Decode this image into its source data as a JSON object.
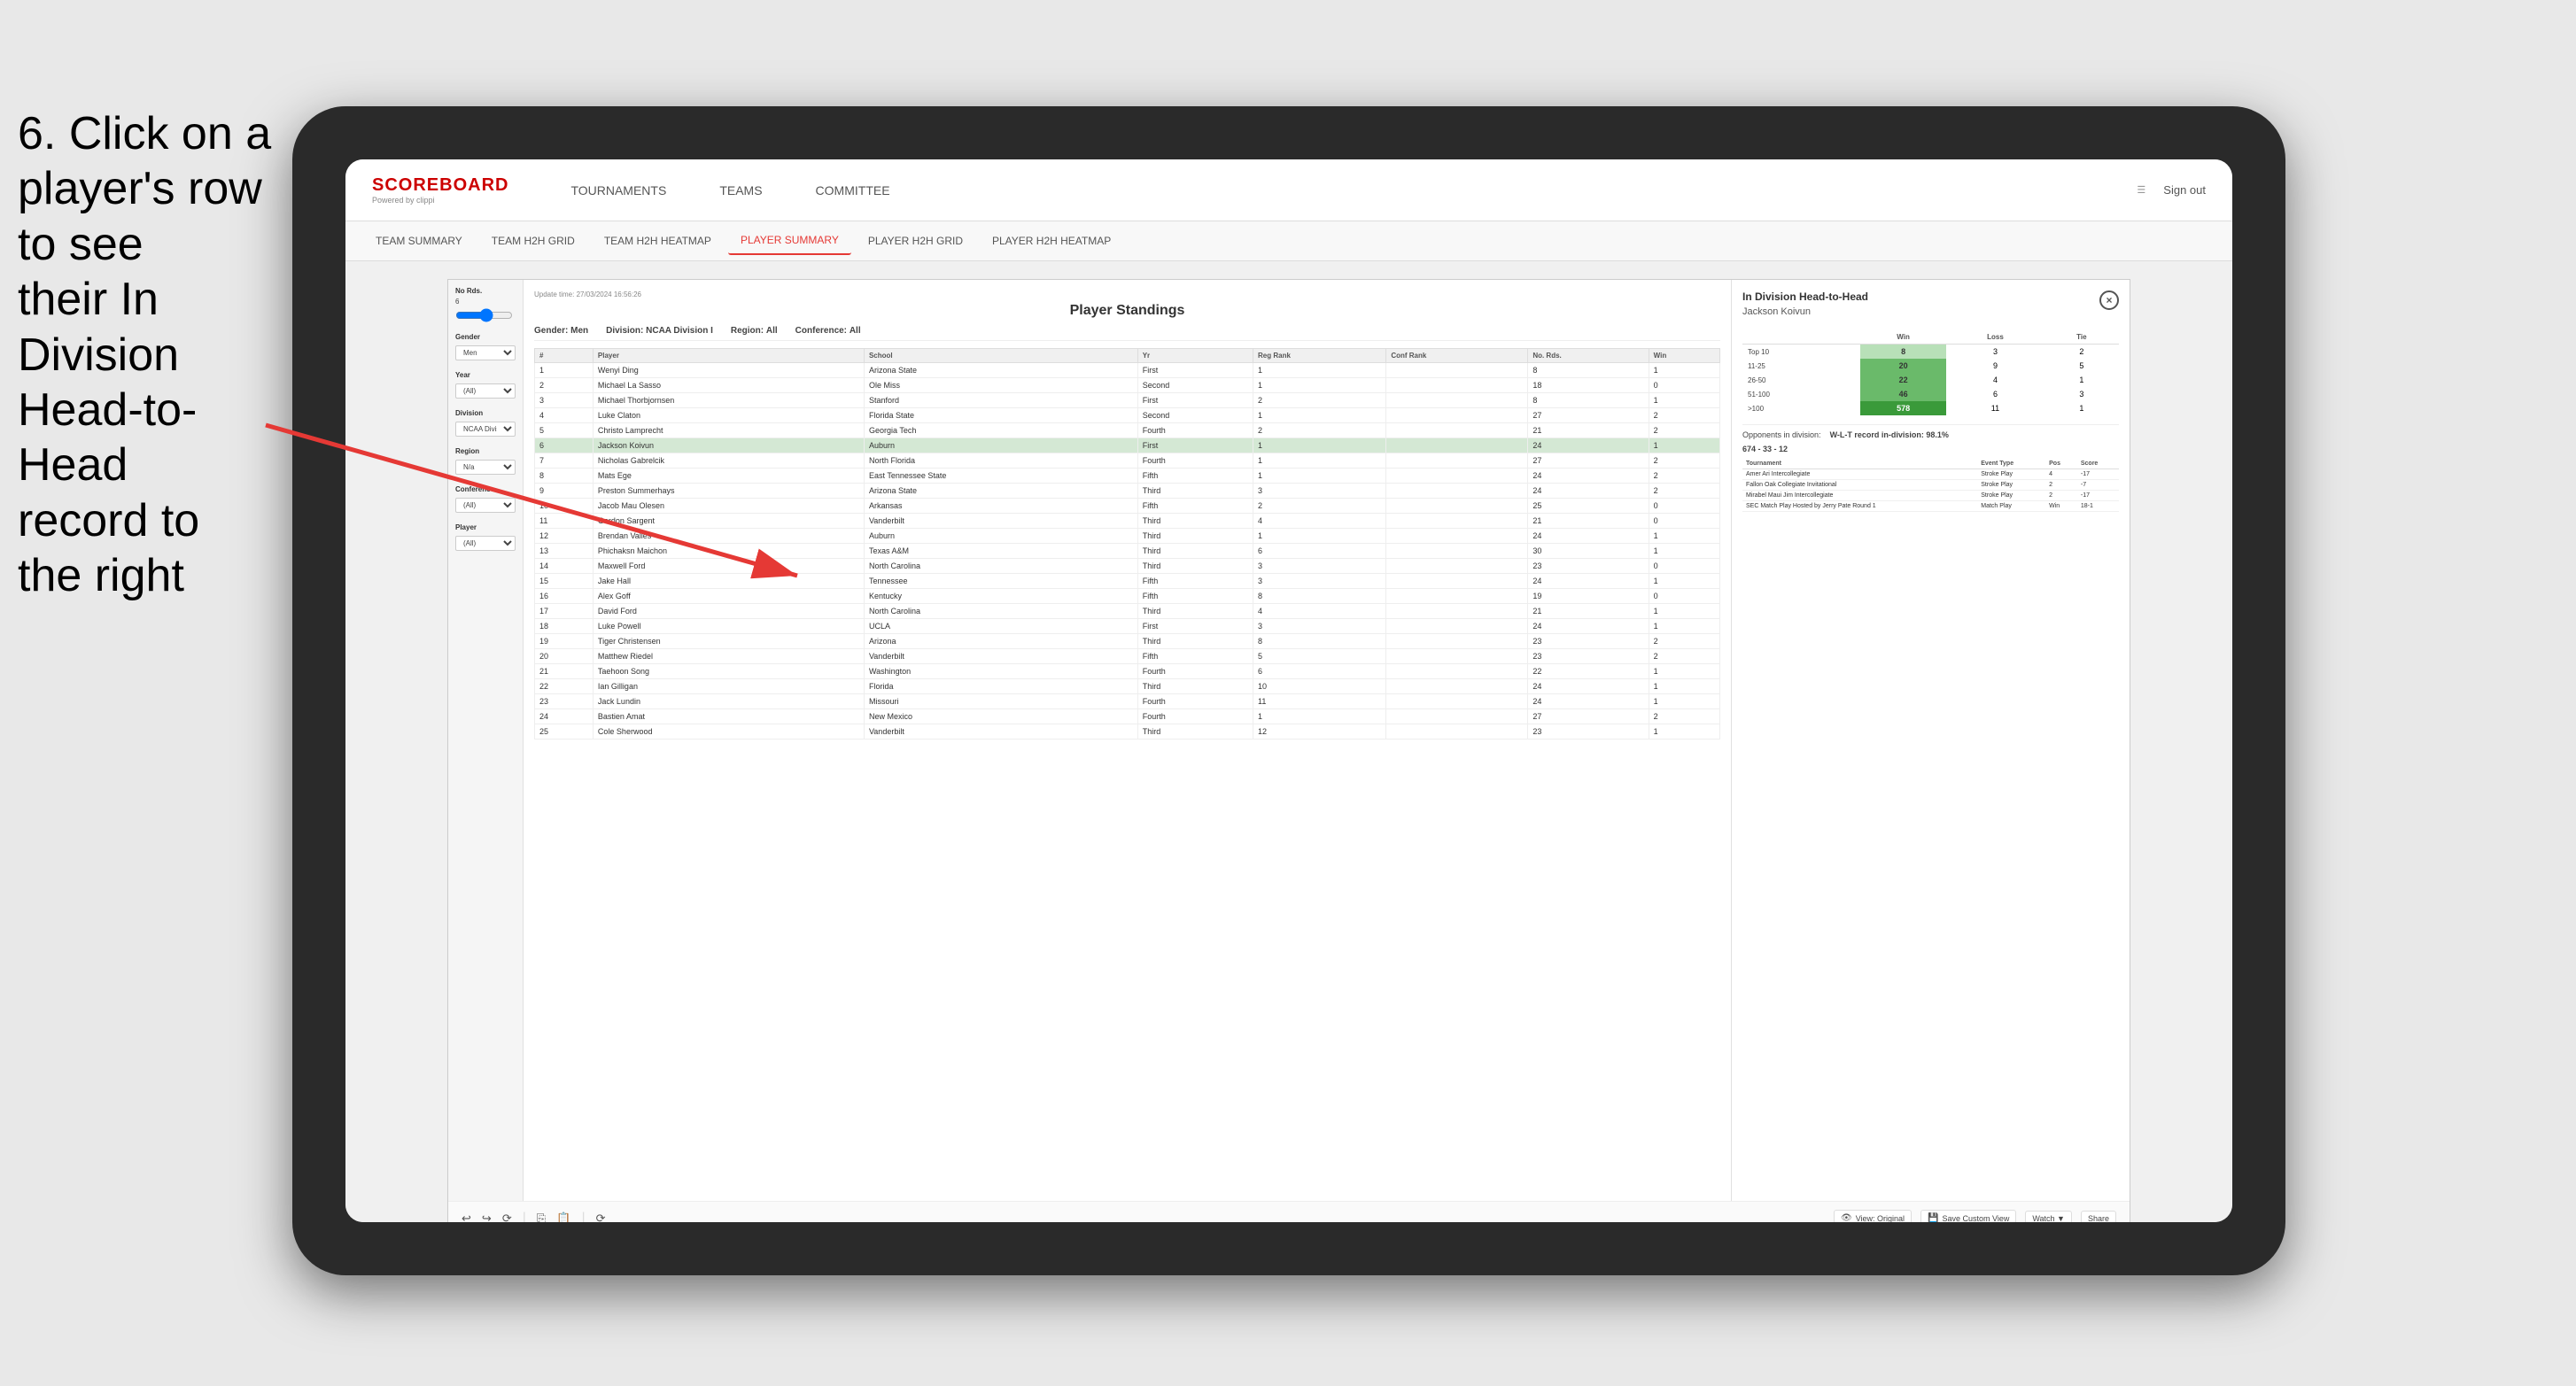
{
  "instruction": {
    "line1": "6. Click on a",
    "line2": "player's row to see",
    "line3": "their In Division",
    "line4": "Head-to-Head",
    "line5": "record to the right"
  },
  "nav": {
    "logo": "SCOREBOARD",
    "logo_sub": "Powered by clippi",
    "items": [
      "TOURNAMENTS",
      "TEAMS",
      "COMMITTEE"
    ],
    "sign_out": "Sign out"
  },
  "sub_nav": {
    "items": [
      "TEAM SUMMARY",
      "TEAM H2H GRID",
      "TEAM H2H HEATMAP",
      "PLAYER SUMMARY",
      "PLAYER H2H GRID",
      "PLAYER H2H HEATMAP"
    ],
    "active": "PLAYER SUMMARY"
  },
  "report": {
    "update_time_label": "Update time:",
    "update_time": "27/03/2024 16:56:26",
    "title": "Player Standings",
    "gender_label": "Gender:",
    "gender_value": "Men",
    "division_label": "Division:",
    "division_value": "NCAA Division I",
    "region_label": "Region:",
    "region_value": "All",
    "conference_label": "Conference:",
    "conference_value": "All"
  },
  "filters": {
    "no_rds_label": "No Rds.",
    "no_rds_value": "6",
    "gender_label": "Gender",
    "gender_value": "Men",
    "year_label": "Year",
    "year_value": "(All)",
    "division_label": "Division",
    "division_value": "NCAA Division I",
    "region_label": "Region",
    "region_value": "N/a",
    "conference_label": "Conference",
    "conference_value": "(All)",
    "player_label": "Player",
    "player_value": "(All)"
  },
  "table": {
    "headers": [
      "#",
      "Player",
      "School",
      "Yr",
      "Reg Rank",
      "Conf Rank",
      "No. Rds.",
      "Win"
    ],
    "rows": [
      {
        "rank": 1,
        "player": "Wenyi Ding",
        "school": "Arizona State",
        "yr": "First",
        "reg_rank": 1,
        "conf_rank": "",
        "rds": 8,
        "win": 1
      },
      {
        "rank": 2,
        "player": "Michael La Sasso",
        "school": "Ole Miss",
        "yr": "Second",
        "reg_rank": 1,
        "conf_rank": "",
        "rds": 18,
        "win": 0
      },
      {
        "rank": 3,
        "player": "Michael Thorbjornsen",
        "school": "Stanford",
        "yr": "First",
        "reg_rank": 2,
        "conf_rank": "",
        "rds": 8,
        "win": 1
      },
      {
        "rank": 4,
        "player": "Luke Claton",
        "school": "Florida State",
        "yr": "Second",
        "reg_rank": 1,
        "conf_rank": "",
        "rds": 27,
        "win": 2
      },
      {
        "rank": 5,
        "player": "Christo Lamprecht",
        "school": "Georgia Tech",
        "yr": "Fourth",
        "reg_rank": 2,
        "conf_rank": "",
        "rds": 21,
        "win": 2
      },
      {
        "rank": 6,
        "player": "Jackson Koivun",
        "school": "Auburn",
        "yr": "First",
        "reg_rank": 1,
        "conf_rank": "",
        "rds": 24,
        "win": 1,
        "highlighted": true
      },
      {
        "rank": 7,
        "player": "Nicholas Gabrelcik",
        "school": "North Florida",
        "yr": "Fourth",
        "reg_rank": 1,
        "conf_rank": "",
        "rds": 27,
        "win": 2
      },
      {
        "rank": 8,
        "player": "Mats Ege",
        "school": "East Tennessee State",
        "yr": "Fifth",
        "reg_rank": 1,
        "conf_rank": "",
        "rds": 24,
        "win": 2
      },
      {
        "rank": 9,
        "player": "Preston Summerhays",
        "school": "Arizona State",
        "yr": "Third",
        "reg_rank": 3,
        "conf_rank": "",
        "rds": 24,
        "win": 2
      },
      {
        "rank": 10,
        "player": "Jacob Mau Olesen",
        "school": "Arkansas",
        "yr": "Fifth",
        "reg_rank": 2,
        "conf_rank": "",
        "rds": 25,
        "win": 0
      },
      {
        "rank": 11,
        "player": "Gordon Sargent",
        "school": "Vanderbilt",
        "yr": "Third",
        "reg_rank": 4,
        "conf_rank": "",
        "rds": 21,
        "win": 0
      },
      {
        "rank": 12,
        "player": "Brendan Valles",
        "school": "Auburn",
        "yr": "Third",
        "reg_rank": 1,
        "conf_rank": "",
        "rds": 24,
        "win": 1
      },
      {
        "rank": 13,
        "player": "Phichaksn Maichon",
        "school": "Texas A&M",
        "yr": "Third",
        "reg_rank": 6,
        "conf_rank": "",
        "rds": 30,
        "win": 1
      },
      {
        "rank": 14,
        "player": "Maxwell Ford",
        "school": "North Carolina",
        "yr": "Third",
        "reg_rank": 3,
        "conf_rank": "",
        "rds": 23,
        "win": 0
      },
      {
        "rank": 15,
        "player": "Jake Hall",
        "school": "Tennessee",
        "yr": "Fifth",
        "reg_rank": 3,
        "conf_rank": "",
        "rds": 24,
        "win": 1
      },
      {
        "rank": 16,
        "player": "Alex Goff",
        "school": "Kentucky",
        "yr": "Fifth",
        "reg_rank": 8,
        "conf_rank": "",
        "rds": 19,
        "win": 0
      },
      {
        "rank": 17,
        "player": "David Ford",
        "school": "North Carolina",
        "yr": "Third",
        "reg_rank": 4,
        "conf_rank": "",
        "rds": 21,
        "win": 1
      },
      {
        "rank": 18,
        "player": "Luke Powell",
        "school": "UCLA",
        "yr": "First",
        "reg_rank": 3,
        "conf_rank": "",
        "rds": 24,
        "win": 1
      },
      {
        "rank": 19,
        "player": "Tiger Christensen",
        "school": "Arizona",
        "yr": "Third",
        "reg_rank": 8,
        "conf_rank": "",
        "rds": 23,
        "win": 2
      },
      {
        "rank": 20,
        "player": "Matthew Riedel",
        "school": "Vanderbilt",
        "yr": "Fifth",
        "reg_rank": 5,
        "conf_rank": "",
        "rds": 23,
        "win": 2
      },
      {
        "rank": 21,
        "player": "Taehoon Song",
        "school": "Washington",
        "yr": "Fourth",
        "reg_rank": 6,
        "conf_rank": "",
        "rds": 22,
        "win": 1
      },
      {
        "rank": 22,
        "player": "Ian Gilligan",
        "school": "Florida",
        "yr": "Third",
        "reg_rank": 10,
        "conf_rank": "",
        "rds": 24,
        "win": 1
      },
      {
        "rank": 23,
        "player": "Jack Lundin",
        "school": "Missouri",
        "yr": "Fourth",
        "reg_rank": 11,
        "conf_rank": "",
        "rds": 24,
        "win": 1
      },
      {
        "rank": 24,
        "player": "Bastien Amat",
        "school": "New Mexico",
        "yr": "Fourth",
        "reg_rank": 1,
        "conf_rank": "",
        "rds": 27,
        "win": 2
      },
      {
        "rank": 25,
        "player": "Cole Sherwood",
        "school": "Vanderbilt",
        "yr": "Third",
        "reg_rank": 12,
        "conf_rank": "",
        "rds": 23,
        "win": 1
      }
    ]
  },
  "h2h": {
    "title": "In Division Head-to-Head",
    "player": "Jackson Koivun",
    "close_btn": "×",
    "table_headers": [
      "",
      "Win",
      "Loss",
      "Tie"
    ],
    "rows": [
      {
        "label": "Top 10",
        "win": 8,
        "loss": 3,
        "tie": 2,
        "win_color": "light"
      },
      {
        "label": "11-25",
        "win": 20,
        "loss": 9,
        "tie": 5,
        "win_color": "mid"
      },
      {
        "label": "26-50",
        "win": 22,
        "loss": 4,
        "tie": 1,
        "win_color": "mid"
      },
      {
        "label": "51-100",
        "win": 46,
        "loss": 6,
        "tie": 3,
        "win_color": "mid"
      },
      {
        "label": ">100",
        "win": 578,
        "loss": 11,
        "tie": 1,
        "win_color": "dark"
      }
    ],
    "opponents_label": "Opponents in division:",
    "opponents_pct": "98.1%",
    "record_label": "W-L-T record in-division:",
    "record": "674 - 33 - 12",
    "tournament_headers": [
      "Tournament",
      "Event Type",
      "Pos",
      "Score"
    ],
    "tournaments": [
      {
        "name": "Amer Ari Intercollegiate",
        "type": "Stroke Play",
        "pos": 4,
        "score": "-17"
      },
      {
        "name": "Fallon Oak Collegiate Invitational",
        "type": "Stroke Play",
        "pos": 2,
        "score": "-7"
      },
      {
        "name": "Mirabel Maui Jim Intercollegiate",
        "type": "Stroke Play",
        "pos": 2,
        "score": "-17"
      },
      {
        "name": "SEC Match Play Hosted by Jerry Pate Round 1",
        "type": "Match Play",
        "pos": "Win",
        "score": "18-1"
      }
    ]
  },
  "toolbar": {
    "view_original": "View: Original",
    "save_custom": "Save Custom View",
    "watch": "Watch ▼",
    "share": "Share"
  }
}
